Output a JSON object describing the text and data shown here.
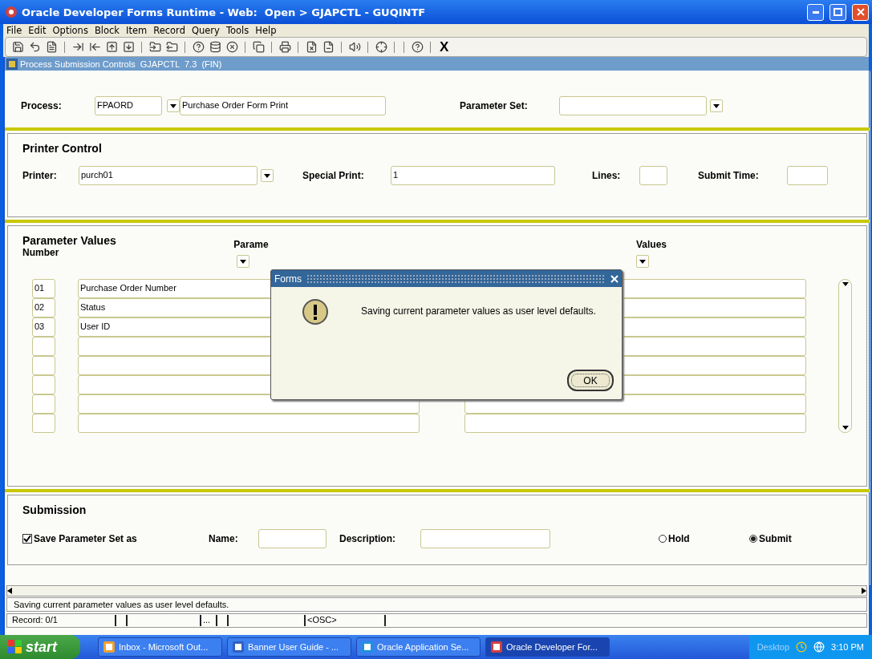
{
  "window": {
    "title": "Oracle Developer Forms Runtime - Web:  Open > GJAPCTL - GUQINTF"
  },
  "menu": [
    "File",
    "Edit",
    "Options",
    "Block",
    "Item",
    "Record",
    "Query",
    "Tools",
    "Help"
  ],
  "toolbar": {
    "exit_label": "X"
  },
  "form_title": "Process Submission Controls  GJAPCTL  7.3  (FIN)",
  "process": {
    "label": "Process:",
    "code": "FPAORD",
    "description": "Purchase Order Form Print",
    "parameter_set_label": "Parameter Set:"
  },
  "printer_control": {
    "title": "Printer Control",
    "printer_label": "Printer:",
    "printer": "purch01",
    "special_print_label": "Special Print:",
    "special_print": "1",
    "lines_label": "Lines:",
    "submit_time_label": "Submit Time:"
  },
  "parameter_values": {
    "title": "Parameter Values",
    "number_header": "Number",
    "parameter_header": "Parame",
    "values_header": "Values",
    "rows": [
      {
        "number": "01",
        "parameter": "Purchase Order Number"
      },
      {
        "number": "02",
        "parameter": "Status"
      },
      {
        "number": "03",
        "parameter": "User ID"
      },
      {},
      {},
      {},
      {},
      {}
    ]
  },
  "dialog": {
    "title": "Forms",
    "message": "Saving current parameter values as user level defaults.",
    "ok": "OK"
  },
  "submission": {
    "title": "Submission",
    "save_label": "Save Parameter Set as",
    "save_checked": true,
    "name_label": "Name:",
    "description_label": "Description:",
    "modes": [
      {
        "label": "Hold",
        "selected": false
      },
      {
        "label": "Submit",
        "selected": true
      }
    ]
  },
  "status_message": "Saving current parameter values as user level defaults.",
  "status_bar": [
    "Record: 0/1",
    "...",
    "<OSC>"
  ],
  "taskbar": {
    "start": "start",
    "items": [
      {
        "label": "Inbox - Microsoft Out...",
        "selected": false
      },
      {
        "label": "Banner User Guide - ...",
        "selected": false
      },
      {
        "label": "Oracle Application Se...",
        "selected": false
      },
      {
        "label": "Oracle Developer For...",
        "selected": true
      }
    ],
    "desktop": "Desktop",
    "time": "3:10 PM"
  }
}
